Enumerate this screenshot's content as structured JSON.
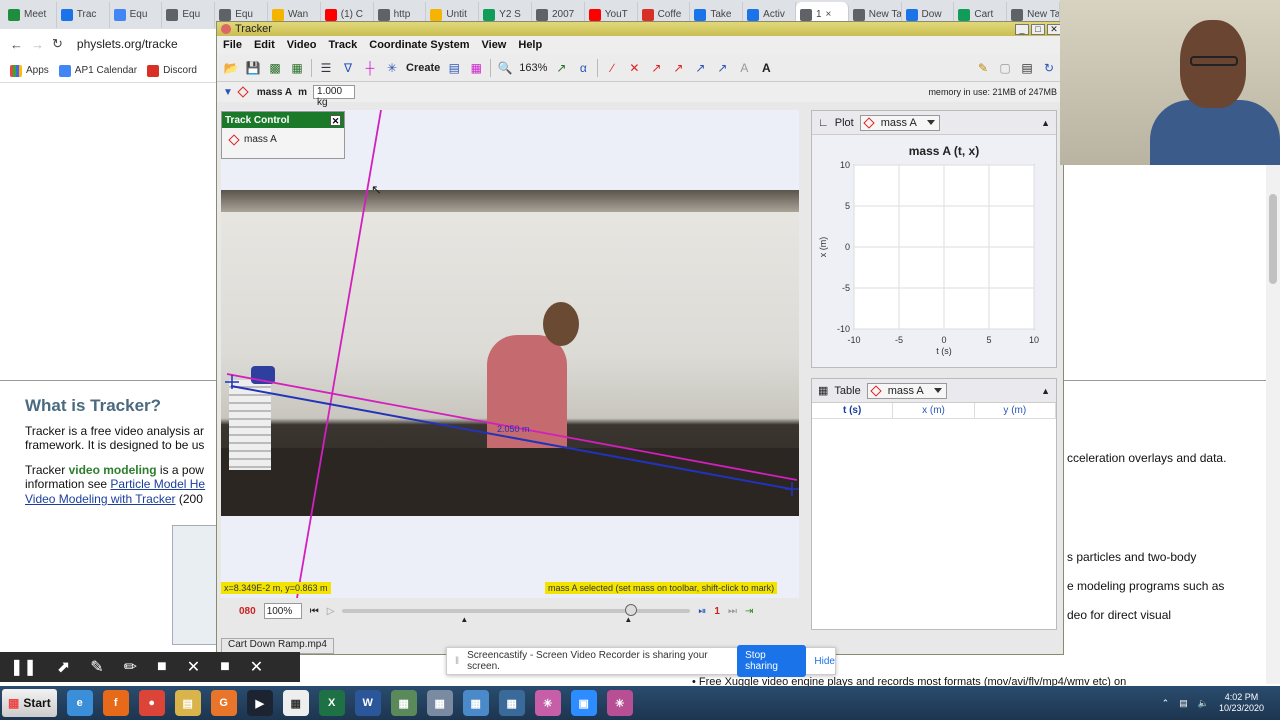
{
  "browser": {
    "tabs": [
      {
        "label": "Meet",
        "color": "#1e8e3e"
      },
      {
        "label": "Trac",
        "color": "#1a73e8"
      },
      {
        "label": "Equ",
        "color": "#4285f4"
      },
      {
        "label": "Equ",
        "color": "#5f6368"
      },
      {
        "label": "Equ",
        "color": "#5f6368"
      },
      {
        "label": "Wan",
        "color": "#f4b400"
      },
      {
        "label": "(1) C",
        "color": "#ff0000"
      },
      {
        "label": "http",
        "color": "#5f6368"
      },
      {
        "label": "Untit",
        "color": "#f4b400"
      },
      {
        "label": "Y2 S",
        "color": "#0f9d58"
      },
      {
        "label": "2007",
        "color": "#5f6368"
      },
      {
        "label": "YouT",
        "color": "#ff0000"
      },
      {
        "label": "Coffe",
        "color": "#d93025"
      },
      {
        "label": "Take",
        "color": "#1a73e8"
      },
      {
        "label": "Activ",
        "color": "#1a73e8"
      },
      {
        "label": "1",
        "color": "#5f6368",
        "active": true
      },
      {
        "label": "New Tab",
        "color": "#5f6368"
      },
      {
        "label": "Dow",
        "color": "#1a73e8"
      },
      {
        "label": "Cart",
        "color": "#0f9d58"
      },
      {
        "label": "New Tab",
        "color": "#5f6368"
      }
    ],
    "url": "physlets.org/tracke",
    "bookmarks": [
      "Apps",
      "AP1 Calendar",
      "Discord"
    ]
  },
  "webpage": {
    "heading": "What is Tracker?",
    "line1": "Tracker is a free video analysis ar",
    "line2": "framework. It is designed to be us",
    "line3_prefix": "Tracker ",
    "line3_bold": "video modeling",
    "line3_suffix": " is a pow",
    "line4_prefix": "information see ",
    "line4_link": "Particle Model He",
    "line5_link": "Video Modeling with Tracker",
    "line5_suffix": " (200",
    "right1": "cceleration overlays and data.",
    "right2": "s particles and two-body",
    "right3": "e modeling programs such as",
    "right4": "deo for direct visual",
    "bottom": "• Free Xuggle video engine plays and records most formats (mov/avi/flv/mp4/wmv etc) on"
  },
  "tracker": {
    "title": "Tracker",
    "menu": [
      "File",
      "Edit",
      "Video",
      "Track",
      "Coordinate System",
      "View",
      "Help"
    ],
    "toolbar": {
      "create_label": "Create",
      "zoom": "163%"
    },
    "massbar": {
      "track": "mass A",
      "m_label": "m",
      "mass_value": "1.000 kg",
      "memory": "memory in use: 21MB of 247MB"
    },
    "track_control": {
      "title": "Track Control",
      "item": "mass A"
    },
    "coord_readout": "x=8.349E-2 m, y=0.863 m",
    "status": "mass A selected (set mass on toolbar, shift-click to mark)",
    "measure_label": "2.050 m",
    "player": {
      "frame": "080",
      "zoom": "100%",
      "step": "1",
      "progress": 0.83
    },
    "video_tab": "Cart Down Ramp.mp4",
    "plot": {
      "label": "Plot",
      "track": "mass A"
    },
    "table": {
      "label": "Table",
      "track": "mass A",
      "columns": [
        "t (s)",
        "x (m)",
        "y (m)"
      ]
    }
  },
  "chart_data": {
    "type": "scatter",
    "title": "mass A (t, x)",
    "xlabel": "t (s)",
    "ylabel": "x (m)",
    "xlim": [
      -10,
      10
    ],
    "ylim": [
      -10,
      10
    ],
    "xticks": [
      -10,
      -5,
      0,
      5,
      10
    ],
    "yticks": [
      10,
      5,
      0,
      -5,
      -10
    ],
    "grid": true,
    "x": [],
    "y": []
  },
  "screencastify": {
    "message": "Screencastify - Screen Video Recorder is sharing your screen.",
    "stop_label": "Stop sharing",
    "hide_label": "Hide"
  },
  "taskbar": {
    "start_label": "Start",
    "time": "4:02 PM",
    "date": "10/23/2020"
  }
}
